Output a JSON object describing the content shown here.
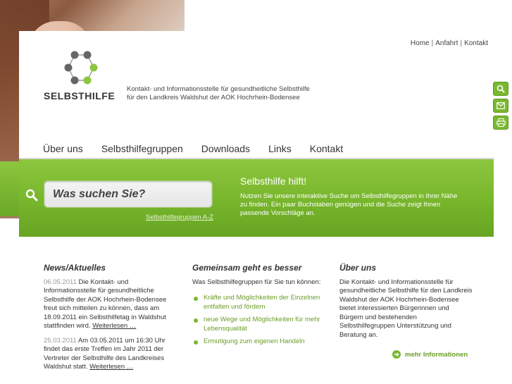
{
  "topnav": {
    "home": "Home",
    "anfahrt": "Anfahrt",
    "kontakt": "Kontakt"
  },
  "brand": {
    "logo_text": "SELBSTHILFE",
    "tagline_1": "Kontakt- und Informationsstelle für gesundheitliche Selbsthilfe",
    "tagline_2": "für den Landkreis Waldshut der AOK Hochrhein-Bodensee"
  },
  "mainnav": [
    "Über uns",
    "Selbsthilfegruppen",
    "Downloads",
    "Links",
    "Kontakt"
  ],
  "search": {
    "placeholder": "Was suchen Sie?",
    "az_link": "Selbsthilfegruppen A-Z"
  },
  "hilft": {
    "title": "Selbsthilfe hilft!",
    "text": "Nutzen Sie unsere interaktive Suche um Selbsthilfegruppen in Ihrer Nähe zu finden. Ein paar Buchstaben genügen und die Suche zeigt Ihnen passende Vorschläge an."
  },
  "side_buttons": [
    "search-icon",
    "mail-icon",
    "print-icon"
  ],
  "news": {
    "title": "News/Aktuelles",
    "items": [
      {
        "date": "06.05.2011",
        "text": "Die Kontakt- und Informationsstelle für gesundheitliche Selbsthilfe der AOK Hochrhein-Bodensee freut sich mitteilen zu können, dass am 18.09.2011 ein Selbsthilfetag in Waldshut stattfinden wird.",
        "more": "Weiterlesen …"
      },
      {
        "date": "25.03.2011",
        "text": "Am 03.05.2011 um 16:30 Uhr findet das erste Treffen im Jahr 2011 der Vertreter der Selbsthilfe des Landkreises Waldshut statt.",
        "more": "Weiterlesen …"
      }
    ]
  },
  "gemeinsam": {
    "title": "Gemeinsam geht es besser",
    "intro": "Was Selbsthilfegruppen für Sie tun können:",
    "bullets": [
      "Kräfte und Möglichkeiten der Einzelnen entfalten und fördern",
      "neue Wege und Möglichkeiten für mehr Lebensqualität",
      "Ermutigung zum eigenen Handeln"
    ]
  },
  "ueber": {
    "title": "Über uns",
    "text": "Die Kontakt- und Informationsstelle für gesundheitliche Selbsthilfe für den Landkreis Waldshut der AOK Hochrhein-Bodensee bietet interessierten Bürgerinnen und Bürgern und bestehenden Selbsthilfegruppen Unterstützung und Beratung an.",
    "more": "mehr Informationen"
  },
  "colors": {
    "accent": "#7ab830",
    "text": "#333333"
  }
}
